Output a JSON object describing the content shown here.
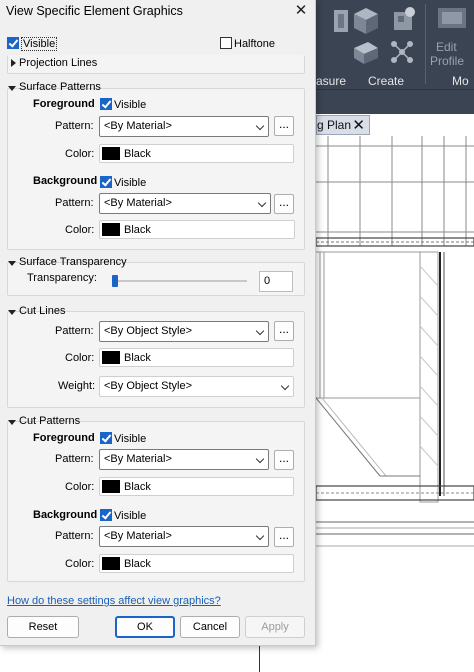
{
  "dialog": {
    "title": "View Specific Element Graphics",
    "close_glyph": "✕",
    "visible_label": "Visible",
    "visible_checked": true,
    "halftone_label": "Halftone",
    "halftone_checked": false,
    "help_link": "How do these settings affect view graphics?",
    "buttons": {
      "reset": "Reset",
      "ok": "OK",
      "cancel": "Cancel",
      "apply": "Apply"
    }
  },
  "sections": {
    "projection_lines": {
      "title": "Projection Lines",
      "expanded": false
    },
    "surface_patterns": {
      "title": "Surface Patterns",
      "foreground": {
        "heading": "Foreground",
        "visible_label": "Visible",
        "visible_checked": true,
        "pattern_label": "Pattern:",
        "pattern_value": "<By Material>",
        "color_label": "Color:",
        "color_value": "Black"
      },
      "background": {
        "heading": "Background",
        "visible_label": "Visible",
        "visible_checked": true,
        "pattern_label": "Pattern:",
        "pattern_value": "<By Material>",
        "color_label": "Color:",
        "color_value": "Black"
      }
    },
    "surface_transparency": {
      "title": "Surface Transparency",
      "label": "Transparency:",
      "value": "0",
      "level_percent": 0
    },
    "cut_lines": {
      "title": "Cut Lines",
      "pattern_label": "Pattern:",
      "pattern_value": "<By Object Style>",
      "color_label": "Color:",
      "color_value": "Black",
      "weight_label": "Weight:",
      "weight_value": "<By Object Style>"
    },
    "cut_patterns": {
      "title": "Cut Patterns",
      "foreground": {
        "heading": "Foreground",
        "visible_label": "Visible",
        "visible_checked": true,
        "pattern_label": "Pattern:",
        "pattern_value": "<By Material>",
        "color_label": "Color:",
        "color_value": "Black"
      },
      "background": {
        "heading": "Background",
        "visible_label": "Visible",
        "visible_checked": true,
        "pattern_label": "Pattern:",
        "pattern_value": "<By Material>",
        "color_label": "Color:",
        "color_value": "Black"
      }
    }
  },
  "background_app": {
    "ribbon_labels": [
      "asure",
      "Create",
      "Mo"
    ],
    "edit_profile_label": [
      "Edit",
      "Profile"
    ],
    "view_tab_label": "g Plan",
    "view_tab_close": "✕",
    "colors": {
      "ribbon": "#3b4453",
      "accent": "#1b64c8",
      "link": "#1a5fb4"
    }
  },
  "dots_glyph": "..."
}
